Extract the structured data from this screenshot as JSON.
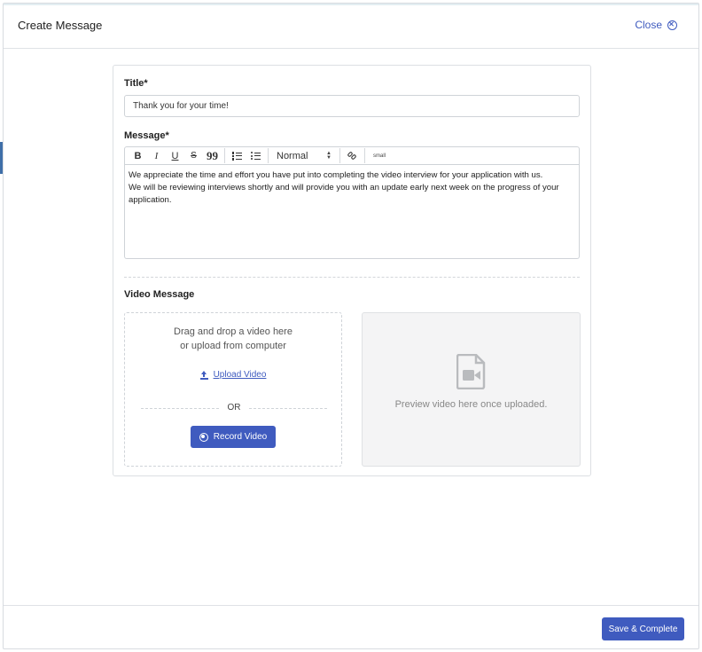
{
  "header": {
    "title": "Create Message",
    "close_label": "Close"
  },
  "form": {
    "title_label": "Title*",
    "title_value": "Thank you for your time!",
    "message_label": "Message*",
    "toolbar": {
      "bold": "B",
      "italic": "I",
      "underline": "U",
      "strike": "S",
      "quote": "99",
      "format_value": "Normal",
      "size_label": "small"
    },
    "message_lines": [
      "We appreciate the time and effort you have put into completing the video interview for your application with us.",
      "We will be reviewing interviews shortly and will provide you with an update early next week on the progress of your application."
    ],
    "video_label": "Video Message"
  },
  "upload": {
    "drop_line1": "Drag and drop a video here",
    "drop_line2": "or upload from computer",
    "upload_label": "Upload Video",
    "or_label": "OR",
    "record_label": "Record Video"
  },
  "preview": {
    "text": "Preview video here once uploaded."
  },
  "footer": {
    "save_label": "Save & Complete"
  },
  "colors": {
    "accent": "#3f5bbf",
    "border": "#cfd3d8",
    "preview_bg": "#f4f4f5"
  }
}
